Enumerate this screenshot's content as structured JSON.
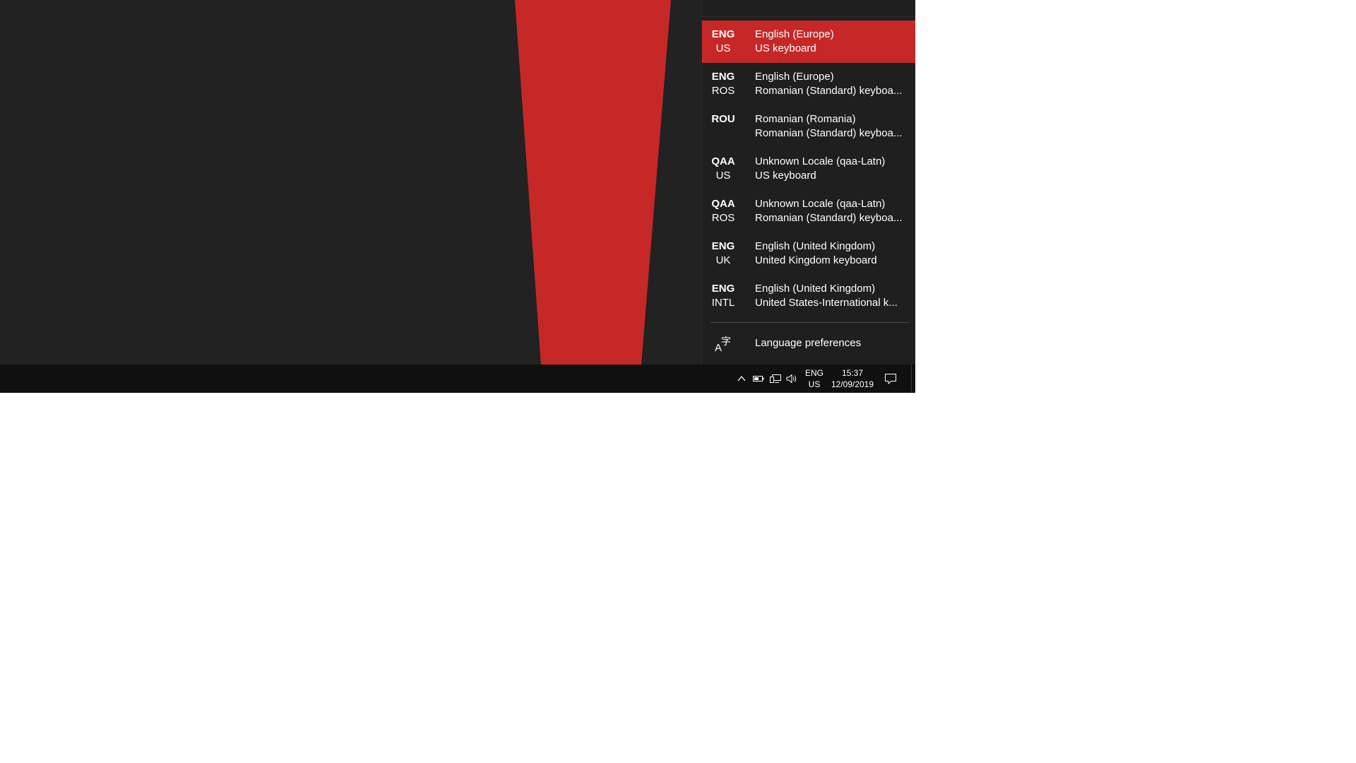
{
  "colors": {
    "accent": "#c62828",
    "desktop_bg": "#222222",
    "flyout_bg": "#1f1f1f",
    "taskbar_bg": "#101010",
    "text": "#ffffff"
  },
  "flyout": {
    "items": [
      {
        "code": "ENG",
        "variant": "US",
        "language": "English (Europe)",
        "keyboard": "US keyboard",
        "selected": true
      },
      {
        "code": "ENG",
        "variant": "ROS",
        "language": "English (Europe)",
        "keyboard": "Romanian (Standard) keyboa...",
        "selected": false
      },
      {
        "code": "ROU",
        "variant": "",
        "language": "Romanian (Romania)",
        "keyboard": "Romanian (Standard) keyboa...",
        "selected": false
      },
      {
        "code": "QAA",
        "variant": "US",
        "language": "Unknown Locale (qaa-Latn)",
        "keyboard": "US keyboard",
        "selected": false
      },
      {
        "code": "QAA",
        "variant": "ROS",
        "language": "Unknown Locale (qaa-Latn)",
        "keyboard": "Romanian (Standard) keyboa...",
        "selected": false
      },
      {
        "code": "ENG",
        "variant": "UK",
        "language": "English (United Kingdom)",
        "keyboard": "United Kingdom keyboard",
        "selected": false
      },
      {
        "code": "ENG",
        "variant": "INTL",
        "language": "English (United Kingdom)",
        "keyboard": "United States-International k...",
        "selected": false
      }
    ],
    "preferences_label": "Language preferences",
    "preferences_icon": "language-settings-icon"
  },
  "taskbar": {
    "tray_icons": [
      "chevron-up-icon",
      "battery-icon",
      "network-icon",
      "volume-icon"
    ],
    "input_indicator": {
      "code": "ENG",
      "variant": "US"
    },
    "clock": {
      "time": "15:37",
      "date": "12/09/2019"
    },
    "notification_icon": "action-center-icon"
  }
}
